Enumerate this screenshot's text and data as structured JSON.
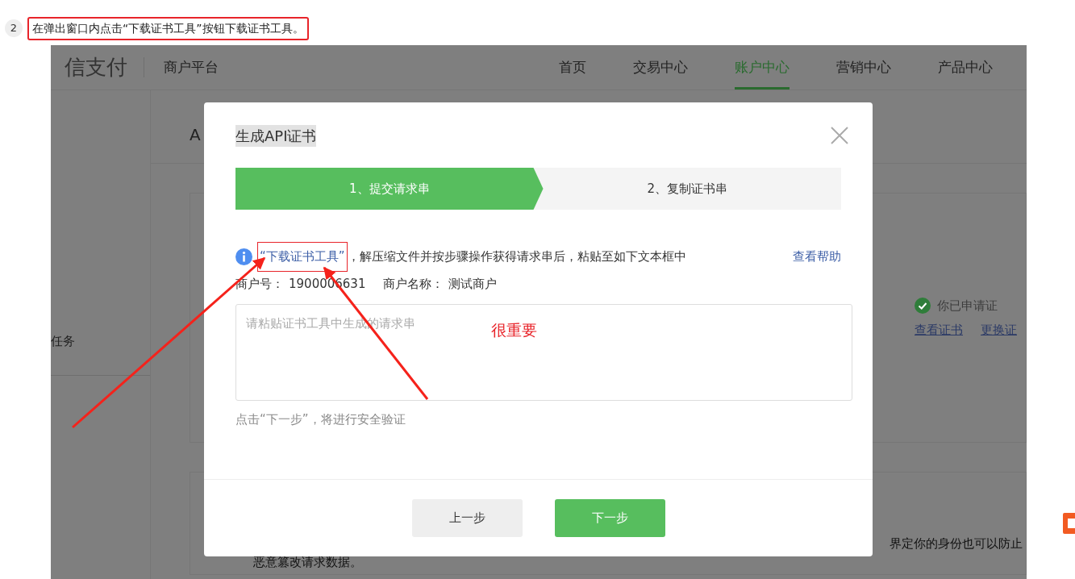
{
  "step": {
    "number": "2",
    "text": "在弹出窗口内点击“下载证书工具”按钮下载证书工具。",
    "boxed": true
  },
  "background_page": {
    "logo": "信支付",
    "platform": "商户平台",
    "nav": [
      {
        "label": "首页",
        "selected": false
      },
      {
        "label": "交易中心",
        "selected": false
      },
      {
        "label": "账户中心",
        "selected": true
      },
      {
        "label": "营销中心",
        "selected": false
      },
      {
        "label": "产品中心",
        "selected": false
      }
    ],
    "sidebar_item": "任务",
    "section_title": "A",
    "status": "你已申请证",
    "links": [
      "查看证书",
      "更换证"
    ],
    "text_1": "界定你的身份也可以防止",
    "text_2": "恶意篡改请求数据。"
  },
  "modal": {
    "title": "生成API证书",
    "steps": [
      {
        "label": "1、提交请求串",
        "selected": true
      },
      {
        "label": "2、复制证书串",
        "selected": false
      }
    ],
    "notice": {
      "link": "“下载证书工具”",
      "link_boxed": true,
      "text": "，解压缩文件并按步骤操作获得请求串后，粘贴至如下文本框中",
      "help": "查看帮助"
    },
    "merchant": {
      "id_label": "商户号：",
      "id": "1900006631",
      "name_label": "商户名称：",
      "name": "测试商户"
    },
    "textarea": {
      "placeholder": "请粘贴证书工具中生成的请求串"
    },
    "hint": "点击“下一步”，将进行安全验证",
    "buttons": [
      {
        "label": "上一步",
        "kind": "secondary"
      },
      {
        "label": "下一步",
        "kind": "primary"
      }
    ]
  },
  "annotation": {
    "note": "很重要"
  }
}
